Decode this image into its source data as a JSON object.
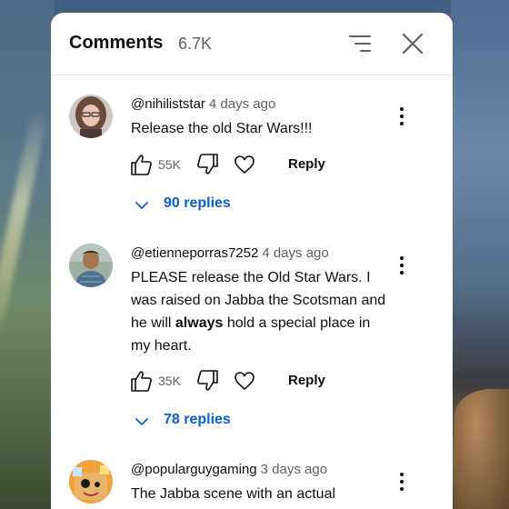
{
  "panel": {
    "title": "Comments",
    "count": "6.7K"
  },
  "comments": [
    {
      "author": "@nihiliststar",
      "time": "4 days ago",
      "text": "Release the old Star Wars!!!",
      "likes": "55K",
      "reply_label": "Reply",
      "replies_label": "90 replies"
    },
    {
      "author": "@etienneporras7252",
      "time": "4 days ago",
      "text_before": "PLEASE release the Old Star Wars. I was raised on Jabba the Scotsman and he will ",
      "text_bold": "always",
      "text_after": " hold a special place in my heart.",
      "likes": "35K",
      "reply_label": "Reply",
      "replies_label": "78 replies"
    },
    {
      "author": "@popularguygaming",
      "time": "3 days ago",
      "text": "The Jabba scene with an actual"
    }
  ],
  "colors": {
    "link": "#065fd4",
    "secondary_text": "#606060",
    "primary_text": "#0f0f0f"
  }
}
